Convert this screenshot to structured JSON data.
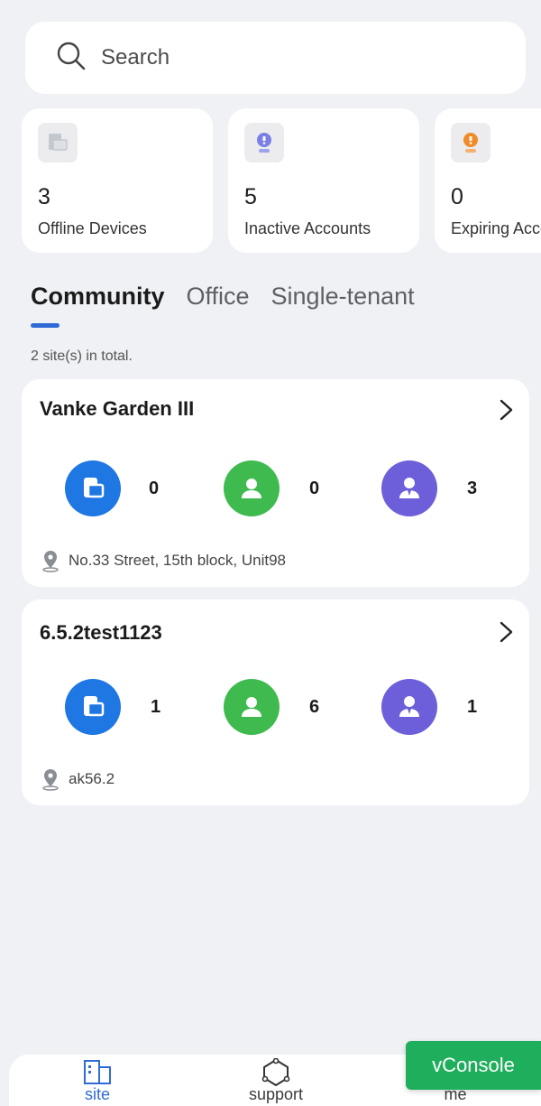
{
  "search": {
    "placeholder": "Search"
  },
  "stats": [
    {
      "value": "3",
      "label": "Offline Devices",
      "icon": "device-icon",
      "color": "#9aa3ad"
    },
    {
      "value": "5",
      "label": "Inactive Accounts",
      "icon": "account-inactive-icon",
      "color": "#6c6fe0"
    },
    {
      "value": "0",
      "label": "Expiring Accounts",
      "icon": "account-expiring-icon",
      "color": "#f08a2a"
    }
  ],
  "tabs": [
    {
      "label": "Community",
      "active": true
    },
    {
      "label": "Office",
      "active": false
    },
    {
      "label": "Single-tenant",
      "active": false
    }
  ],
  "site_count": "2 site(s) in total.",
  "sites": [
    {
      "name": "Vanke Garden III",
      "metrics": [
        {
          "icon": "device-icon",
          "color": "#1e77e3",
          "value": "0"
        },
        {
          "icon": "resident-icon",
          "color": "#3fba4f",
          "value": "0"
        },
        {
          "icon": "property-manager-icon",
          "color": "#6c5fd9",
          "value": "3"
        }
      ],
      "address": "No.33 Street, 15th block, Unit98"
    },
    {
      "name": "6.5.2test1123",
      "metrics": [
        {
          "icon": "device-icon",
          "color": "#1e77e3",
          "value": "1"
        },
        {
          "icon": "resident-icon",
          "color": "#3fba4f",
          "value": "6"
        },
        {
          "icon": "property-manager-icon",
          "color": "#6c5fd9",
          "value": "1"
        }
      ],
      "address": "ak56.2"
    }
  ],
  "bottom_nav": [
    {
      "label": "site",
      "icon": "site-icon",
      "active": true
    },
    {
      "label": "support",
      "icon": "support-icon",
      "active": false
    },
    {
      "label": "me",
      "icon": "me-icon",
      "active": false
    }
  ],
  "vconsole": {
    "label": "vConsole",
    "color": "#1fae5b"
  },
  "accent_color": "#2f6bd8"
}
